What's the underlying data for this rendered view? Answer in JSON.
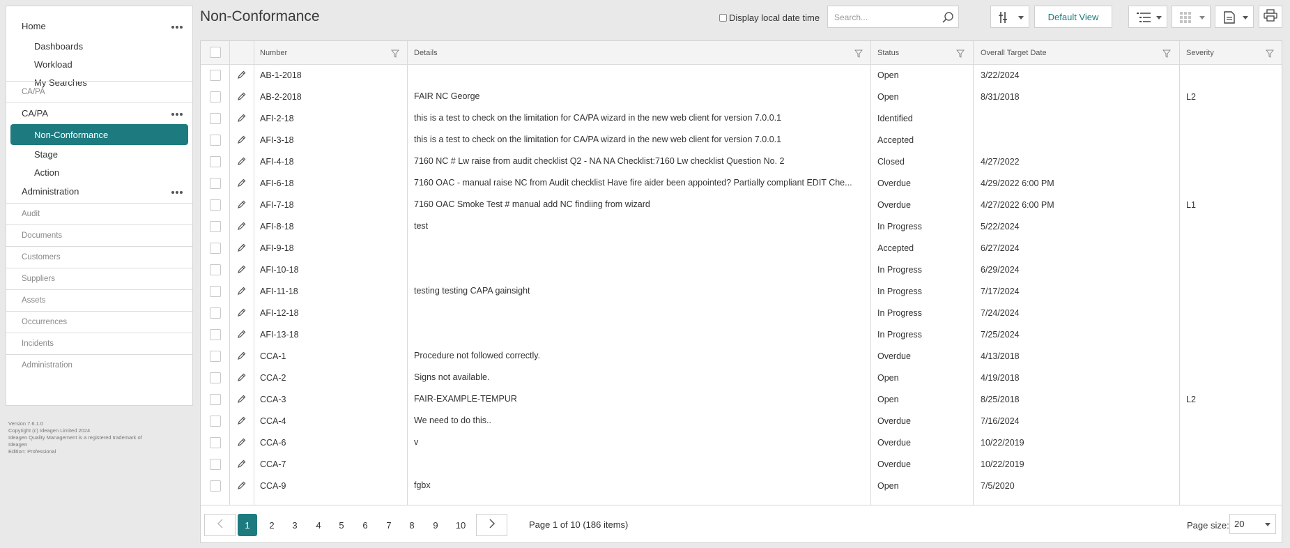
{
  "sidebar": {
    "home": "Home",
    "dashboards": "Dashboards",
    "workload": "Workload",
    "my_searches": "My Searches",
    "capa_header": "CA/PA",
    "capa": "CA/PA",
    "non_conformance": "Non-Conformance",
    "stage": "Stage",
    "action": "Action",
    "administration": "Administration",
    "modules": [
      "Audit",
      "Documents",
      "Customers",
      "Suppliers",
      "Assets",
      "Occurrences",
      "Incidents",
      "Administration"
    ],
    "footer": [
      "Version 7.6.1.0",
      "Copyright (c) Ideagen Limited 2024",
      "Ideagen Quality Management is a registered trademark of",
      "Ideagen",
      "Edition: Professional"
    ]
  },
  "header": {
    "title": "Non-Conformance",
    "local_time_label": "Display local date time",
    "search_placeholder": "Search...",
    "default_view": "Default View"
  },
  "grid": {
    "columns": {
      "number": "Number",
      "details": "Details",
      "status": "Status",
      "target": "Overall Target Date",
      "severity": "Severity"
    },
    "rows": [
      {
        "number": "AB-1-2018",
        "details": "",
        "status": "Open",
        "target": "3/22/2024",
        "severity": ""
      },
      {
        "number": "AB-2-2018",
        "details": "FAIR NC George",
        "status": "Open",
        "target": "8/31/2018",
        "severity": "L2"
      },
      {
        "number": "AFI-2-18",
        "details": "this is a test to check on the limitation for CA/PA wizard in the new web client for version 7.0.0.1",
        "status": "Identified",
        "target": "",
        "severity": ""
      },
      {
        "number": "AFI-3-18",
        "details": "this is a test to check on the limitation for CA/PA wizard in the new web client for version 7.0.0.1",
        "status": "Accepted",
        "target": "",
        "severity": ""
      },
      {
        "number": "AFI-4-18",
        "details": "7160 NC # Lw raise from audit checklist Q2 - NA NA Checklist:7160 Lw checklist Question No. 2",
        "status": "Closed",
        "target": "4/27/2022",
        "severity": ""
      },
      {
        "number": "AFI-6-18",
        "details": "7160 OAC - manual raise NC from Audit checklist Have fire aider been appointed? Partially compliant EDIT Che...",
        "status": "Overdue",
        "target": "4/29/2022 6:00 PM",
        "severity": ""
      },
      {
        "number": "AFI-7-18",
        "details": "7160 OAC Smoke Test # manual add NC findiing from wizard",
        "status": "Overdue",
        "target": "4/27/2022 6:00 PM",
        "severity": "L1"
      },
      {
        "number": "AFI-8-18",
        "details": "test",
        "status": "In Progress",
        "target": "5/22/2024",
        "severity": ""
      },
      {
        "number": "AFI-9-18",
        "details": "",
        "status": "Accepted",
        "target": "6/27/2024",
        "severity": ""
      },
      {
        "number": "AFI-10-18",
        "details": "",
        "status": "In Progress",
        "target": "6/29/2024",
        "severity": ""
      },
      {
        "number": "AFI-11-18",
        "details": "testing testing CAPA gainsight",
        "status": "In Progress",
        "target": "7/17/2024",
        "severity": ""
      },
      {
        "number": "AFI-12-18",
        "details": "",
        "status": "In Progress",
        "target": "7/24/2024",
        "severity": ""
      },
      {
        "number": "AFI-13-18",
        "details": "",
        "status": "In Progress",
        "target": "7/25/2024",
        "severity": ""
      },
      {
        "number": "CCA-1",
        "details": "Procedure not followed correctly.",
        "status": "Overdue",
        "target": "4/13/2018",
        "severity": ""
      },
      {
        "number": "CCA-2",
        "details": "Signs not available.",
        "status": "Open",
        "target": "4/19/2018",
        "severity": ""
      },
      {
        "number": "CCA-3",
        "details": "FAIR-EXAMPLE-TEMPUR",
        "status": "Open",
        "target": "8/25/2018",
        "severity": "L2"
      },
      {
        "number": "CCA-4",
        "details": "We need to do this..",
        "status": "Overdue",
        "target": "7/16/2024",
        "severity": ""
      },
      {
        "number": "CCA-6",
        "details": "v",
        "status": "Overdue",
        "target": "10/22/2019",
        "severity": ""
      },
      {
        "number": "CCA-7",
        "details": "",
        "status": "Overdue",
        "target": "10/22/2019",
        "severity": ""
      },
      {
        "number": "CCA-9",
        "details": "fgbx",
        "status": "Open",
        "target": "7/5/2020",
        "severity": ""
      }
    ]
  },
  "pager": {
    "pages": [
      "1",
      "2",
      "3",
      "4",
      "5",
      "6",
      "7",
      "8",
      "9",
      "10"
    ],
    "current": "1",
    "info": "Page 1 of 10 (186 items)",
    "page_size_label": "Page size:",
    "page_size": "20"
  },
  "colors": {
    "accent": "#1d7b80"
  }
}
